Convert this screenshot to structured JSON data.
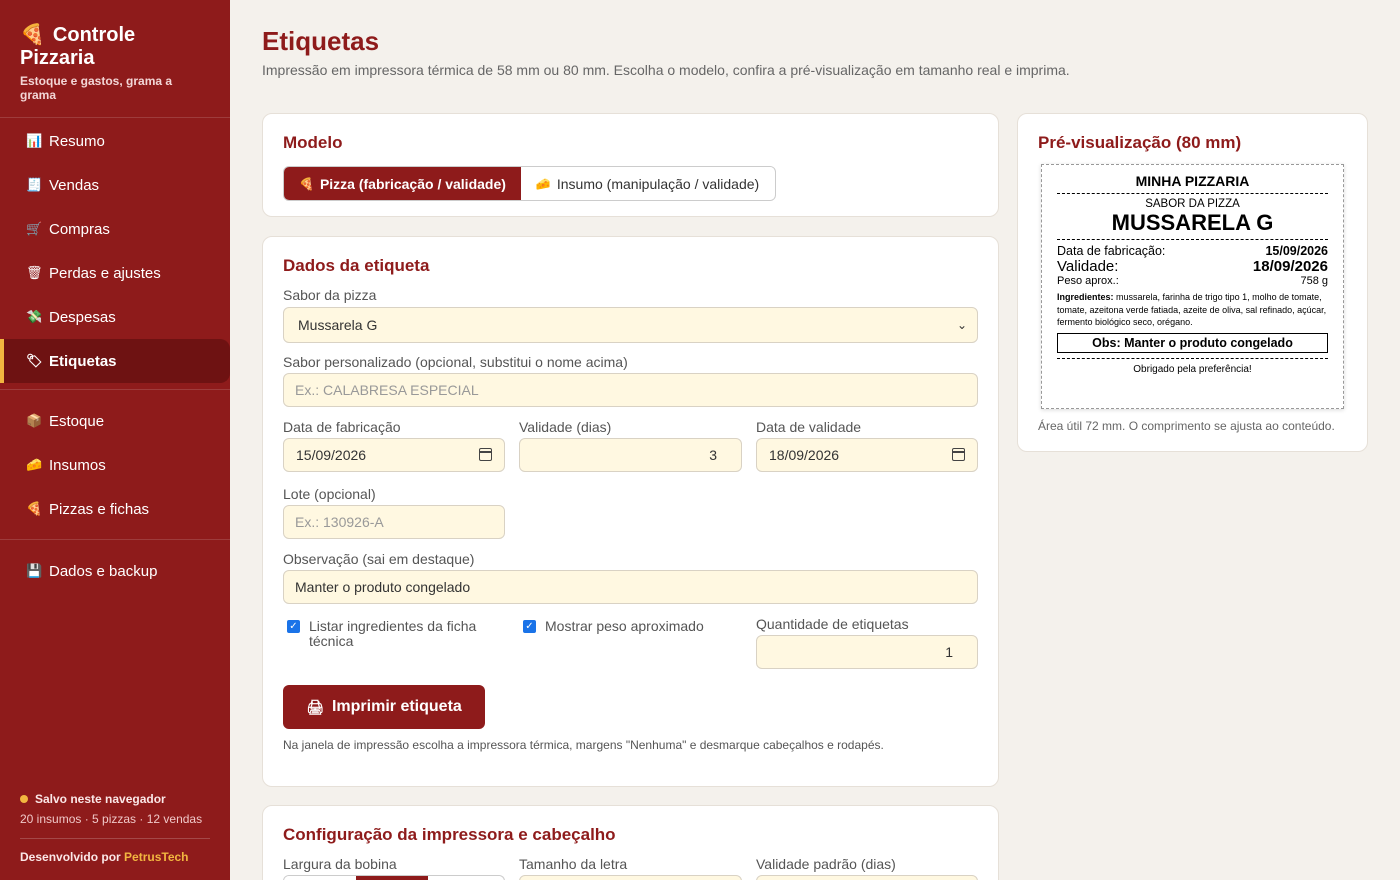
{
  "sidebar": {
    "brand_icon": "🍕",
    "brand_title": "Controle Pizzaria",
    "brand_subtitle": "Estoque e gastos, grama a grama",
    "group1": [
      {
        "icon": "📊",
        "label": "Resumo"
      },
      {
        "icon": "🧾",
        "label": "Vendas"
      },
      {
        "icon": "🛒",
        "label": "Compras"
      },
      {
        "icon": "🗑",
        "label": "Perdas e ajustes"
      },
      {
        "icon": "💸",
        "label": "Despesas"
      },
      {
        "icon": "🏷",
        "label": "Etiquetas"
      }
    ],
    "group2": [
      {
        "icon": "📦",
        "label": "Estoque"
      },
      {
        "icon": "🧀",
        "label": "Insumos"
      },
      {
        "icon": "🍕",
        "label": "Pizzas e fichas"
      }
    ],
    "group3": [
      {
        "icon": "💾",
        "label": "Dados e backup"
      }
    ],
    "saved_text": "Salvo neste navegador",
    "counts_text": "20 insumos · 5 pizzas · 12 vendas",
    "dev_prefix": "Desenvolvido por",
    "dev_name": "PetrusTech",
    "accent": "#f2b640",
    "brand_color": "#8e1b1b"
  },
  "page": {
    "title": "Etiquetas",
    "description": "Impressão em impressora térmica de 58 mm ou 80 mm. Escolha o modelo, confira a pré-visualização em tamanho real e imprima."
  },
  "model": {
    "heading": "Modelo",
    "option_pizza": "Pizza (fabricação / validade)",
    "option_insumo": "Insumo (manipulação / validade)"
  },
  "form": {
    "heading": "Dados da etiqueta",
    "flavor_label": "Sabor da pizza",
    "flavor_value": "Mussarela G",
    "custom_label": "Sabor personalizado (opcional, substitui o nome acima)",
    "custom_placeholder": "Ex.: CALABRESA ESPECIAL",
    "fab_label": "Data de fabricação",
    "fab_value": "15/09/2026",
    "days_label": "Validade (dias)",
    "days_value": "3",
    "val_label": "Data de validade",
    "val_value": "18/09/2026",
    "lot_label": "Lote (opcional)",
    "lot_placeholder": "Ex.: 130926-A",
    "obs_label": "Observação (sai em destaque)",
    "obs_value": "Manter o produto congelado",
    "check_ing": "Listar ingredientes da ficha técnica",
    "check_weight": "Mostrar peso aproximado",
    "qty_label": "Quantidade de etiquetas",
    "qty_value": "1",
    "print_label": "Imprimir etiqueta",
    "hint": "Na janela de impressão escolha a impressora térmica, margens \"Nenhuma\" e desmarque cabeçalhos e rodapés."
  },
  "config": {
    "heading": "Configuração da impressora e cabeçalho",
    "width_label": "Largura da bobina",
    "font_label": "Tamanho da letra",
    "default_days_label": "Validade padrão (dias)"
  },
  "preview": {
    "heading": "Pré-visualização (80 mm)",
    "store": "MINHA PIZZARIA",
    "flavor_caption": "SABOR DA PIZZA",
    "flavor": "MUSSARELA G",
    "fab_label": "Data de fabricação:",
    "fab_value": "15/09/2026",
    "val_label": "Validade:",
    "val_value": "18/09/2026",
    "weight_label": "Peso aprox.:",
    "weight_value": "758 g",
    "ing_label": "Ingredientes:",
    "ing_text": "mussarela, farinha de trigo tipo 1, molho de tomate, tomate, azeitona verde fatiada, azeite de oliva, sal refinado, açúcar, fermento biológico seco, orégano.",
    "obs": "Obs: Manter o produto congelado",
    "thanks": "Obrigado pela preferência!",
    "note": "Área útil 72 mm. O comprimento se ajusta ao conteúdo."
  }
}
